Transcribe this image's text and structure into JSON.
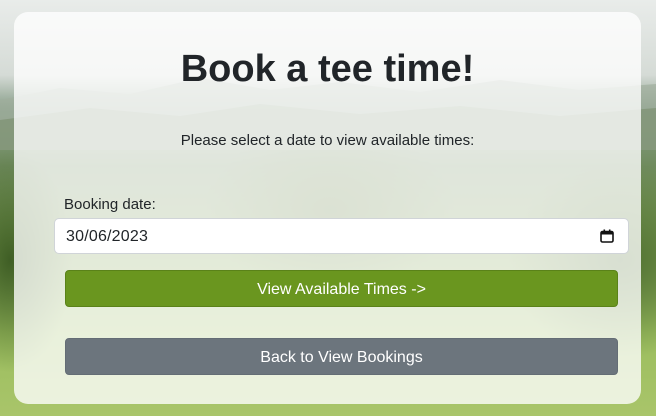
{
  "page": {
    "title": "Book a tee time!",
    "instructions": "Please select a date to view available times:"
  },
  "form": {
    "date_label": "Booking date:",
    "date_value": "30/06/2023",
    "view_times_button": "View Available Times ->",
    "back_button": "Back to View Bookings"
  },
  "icons": {
    "date_picker": "calendar-icon",
    "background": "golf-course-photo"
  },
  "colors": {
    "primary_button": "#6a961f",
    "secondary_button": "#6c757d",
    "text": "#212529"
  }
}
